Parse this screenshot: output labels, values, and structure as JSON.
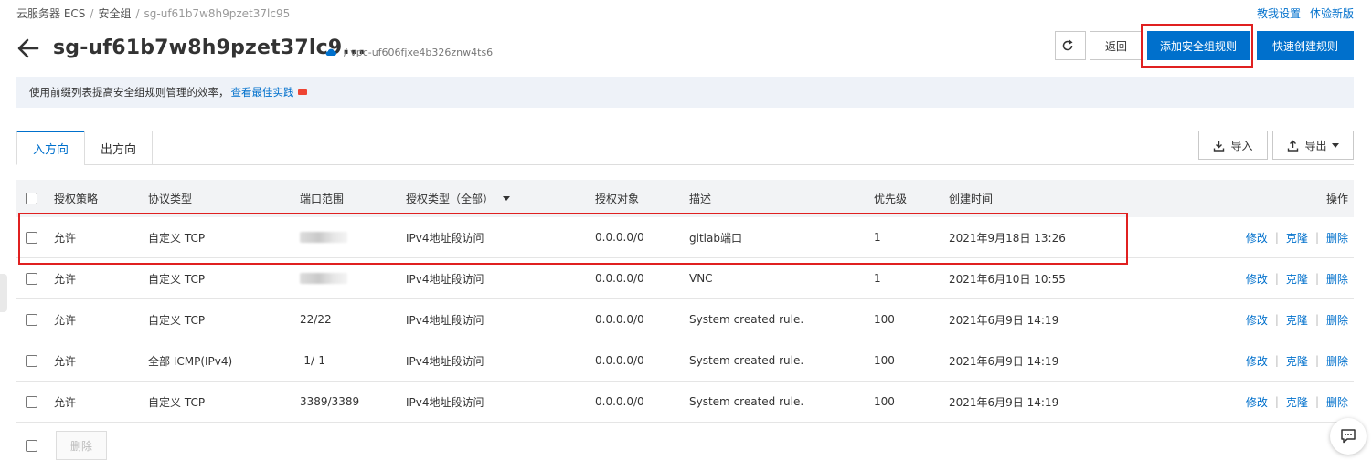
{
  "breadcrumb": {
    "items": [
      "云服务器 ECS",
      "安全组",
      "sg-uf61b7w8h9pzet37lc95"
    ]
  },
  "top_links": {
    "tutorial": "教我设置",
    "new_version": "体验新版"
  },
  "header": {
    "title": "sg-uf61b7w8h9pzet37lc9...",
    "vpc": "/ vpc-uf606fjxe4b326znw4ts6",
    "back_label": "返回",
    "add_rule_label": "添加安全组规则",
    "quick_rule_label": "快速创建规则"
  },
  "notice": {
    "text": "使用前缀列表提高安全组规则管理的效率，",
    "link": "查看最佳实践"
  },
  "tabs": [
    {
      "label": "入方向",
      "active": true
    },
    {
      "label": "出方向",
      "active": false
    }
  ],
  "toolbar": {
    "import_label": "导入",
    "export_label": "导出"
  },
  "table": {
    "headers": {
      "policy": "授权策略",
      "protocol": "协议类型",
      "port": "端口范围",
      "auth_type": "授权类型（全部）",
      "target": "授权对象",
      "desc": "描述",
      "priority": "优先级",
      "created": "创建时间",
      "ops": "操作"
    },
    "op_labels": {
      "edit": "修改",
      "clone": "克隆",
      "delete": "删除"
    },
    "rows": [
      {
        "policy": "允许",
        "protocol": "自定义 TCP",
        "port": "",
        "port_blurred": true,
        "auth_type": "IPv4地址段访问",
        "target": "0.0.0.0/0",
        "desc": "gitlab端口",
        "priority": "1",
        "created": "2021年9月18日 13:26"
      },
      {
        "policy": "允许",
        "protocol": "自定义 TCP",
        "port": "",
        "port_blurred": true,
        "auth_type": "IPv4地址段访问",
        "target": "0.0.0.0/0",
        "desc": "VNC",
        "priority": "1",
        "created": "2021年6月10日 10:55"
      },
      {
        "policy": "允许",
        "protocol": "自定义 TCP",
        "port": "22/22",
        "port_blurred": false,
        "auth_type": "IPv4地址段访问",
        "target": "0.0.0.0/0",
        "desc": "System created rule.",
        "priority": "100",
        "created": "2021年6月9日 14:19"
      },
      {
        "policy": "允许",
        "protocol": "全部 ICMP(IPv4)",
        "port": "-1/-1",
        "port_blurred": false,
        "auth_type": "IPv4地址段访问",
        "target": "0.0.0.0/0",
        "desc": "System created rule.",
        "priority": "100",
        "created": "2021年6月9日 14:19"
      },
      {
        "policy": "允许",
        "protocol": "自定义 TCP",
        "port": "3389/3389",
        "port_blurred": false,
        "auth_type": "IPv4地址段访问",
        "target": "0.0.0.0/0",
        "desc": "System created rule.",
        "priority": "100",
        "created": "2021年6月9日 14:19"
      }
    ]
  },
  "footer": {
    "delete_label": "删除"
  },
  "colors": {
    "primary": "#0070cc",
    "highlight": "#e02020",
    "notice_bg": "#eef2f8"
  }
}
